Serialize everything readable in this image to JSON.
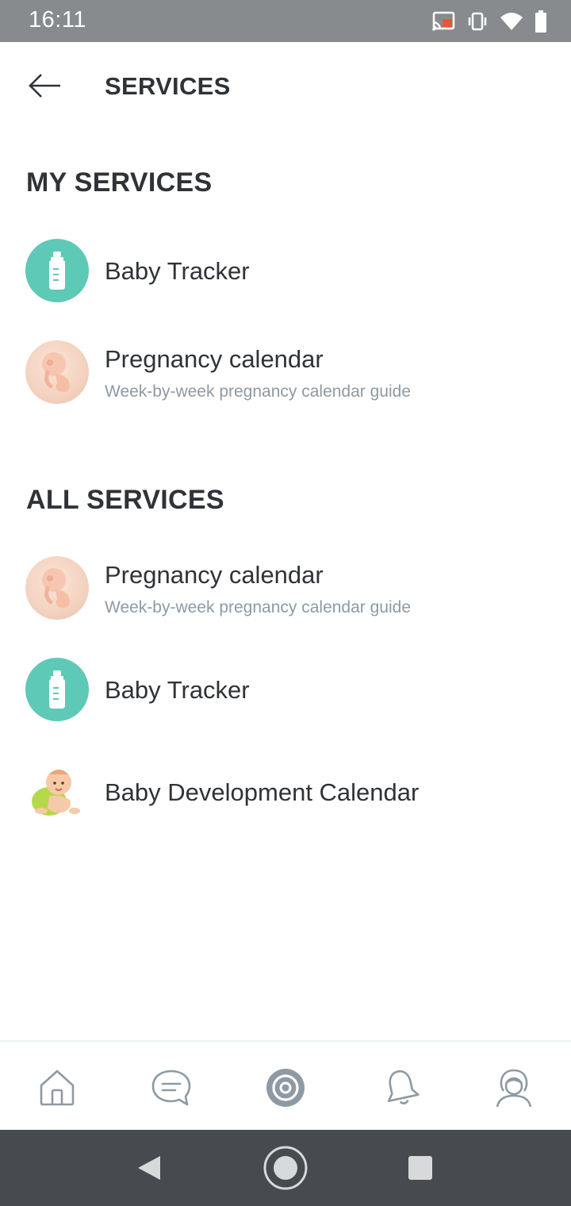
{
  "status_bar": {
    "time": "16:11",
    "icons": [
      "cast-icon",
      "vibrate-icon",
      "wifi-icon",
      "battery-icon"
    ]
  },
  "header": {
    "title": "SERVICES",
    "back_icon": "arrow-left-icon"
  },
  "my_services": {
    "title": "MY SERVICES",
    "items": [
      {
        "title": "Baby Tracker",
        "subtitle": "",
        "icon": "baby-bottle-icon"
      },
      {
        "title": "Pregnancy calendar",
        "subtitle": "Week-by-week pregnancy calendar guide",
        "icon": "embryo-icon"
      }
    ]
  },
  "all_services": {
    "title": "ALL SERVICES",
    "items": [
      {
        "title": "Pregnancy calendar",
        "subtitle": "Week-by-week pregnancy calendar guide",
        "icon": "embryo-icon"
      },
      {
        "title": "Baby Tracker",
        "subtitle": "",
        "icon": "baby-bottle-icon"
      },
      {
        "title": "Baby Development Calendar",
        "subtitle": "",
        "icon": "baby-crawling-icon"
      }
    ]
  },
  "bottom_nav": {
    "items": [
      "home-icon",
      "chat-icon",
      "services-target-icon",
      "bell-icon",
      "profile-icon"
    ],
    "active": "services-target-icon"
  },
  "colors": {
    "status_bar": "#888b8d",
    "tracker_icon_bg": "#5ec9b6",
    "subtitle": "#8d9aa3",
    "text": "#2f3337",
    "android_bar": "#474b4f"
  }
}
